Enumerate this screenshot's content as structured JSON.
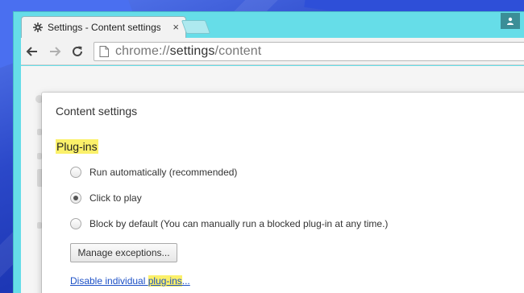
{
  "tab": {
    "title": "Settings - Content settings",
    "close_label": "×",
    "icon": "gear-icon"
  },
  "toolbar": {
    "back_icon": "back-arrow-icon",
    "forward_icon": "forward-arrow-icon",
    "reload_icon": "reload-icon",
    "url_scheme": "chrome://",
    "url_host": "settings",
    "url_path": "/content"
  },
  "profile_icon": "person-icon",
  "dialog": {
    "title": "Content settings",
    "section": "Plug-ins",
    "options": [
      {
        "label": "Run automatically (recommended)",
        "checked": false
      },
      {
        "label": "Click to play",
        "checked": true
      },
      {
        "label": "Block by default (You can manually run a blocked plug-in at any time.)",
        "checked": false
      }
    ],
    "manage_button": "Manage exceptions...",
    "link_prefix": "Disable individual ",
    "link_highlight": "plug-ins",
    "link_suffix": "..."
  },
  "colors": {
    "frame": "#66dde8",
    "highlight": "#fbf06a",
    "link": "#1b4fc6"
  }
}
